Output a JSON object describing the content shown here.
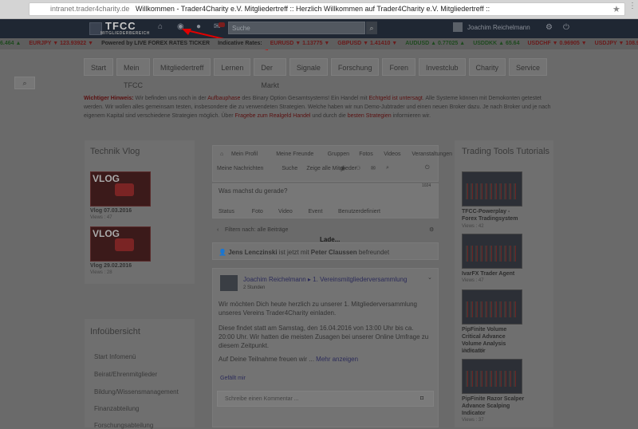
{
  "browser": {
    "url_host": "intranet.trader4charity.de",
    "page_title": "Willkommen - Trader4Charity e.V. Mitgliedertreff :: Herzlich Willkommen auf Trader4Charity e.V. Mitgliedertreff ::"
  },
  "header": {
    "logo_main": "TFCC",
    "logo_sub": "MITGLIEDERBEREICH",
    "search_placeholder": "Suche",
    "username": "Joachim Reichelmann"
  },
  "ticker": [
    {
      "text": "6.464 ▲",
      "color": "green"
    },
    {
      "text": "EURJPY ▼ 123.93922 ▼",
      "color": "red"
    },
    {
      "text": "Powered by LIVE FOREX RATES TICKER",
      "color": "plain"
    },
    {
      "text": "Indicative Rates:",
      "color": "plain"
    },
    {
      "text": "EURUSD ▼ 1.13775 ▼",
      "color": "red"
    },
    {
      "text": "GBPUSD ▼ 1.41410 ▼",
      "color": "red"
    },
    {
      "text": "AUDUSD ▲ 0.77025 ▲",
      "color": "green"
    },
    {
      "text": "USDDKK ▲ 65.64",
      "color": "green"
    },
    {
      "text": "USDCHF ▼ 0.96905 ▼",
      "color": "red"
    },
    {
      "text": "USDJPY ▼ 108.958 ▼",
      "color": "red"
    }
  ],
  "tabs": [
    "Start",
    "Mein TFCC",
    "Mitgliedertreff",
    "Lernen",
    "Der Markt",
    "Signale",
    "Forschung",
    "Foren",
    "Investclub",
    "Charity",
    "Service"
  ],
  "notice": {
    "label": "Wichtiger Hinweis:",
    "text1": " Wir befinden uns noch in der ",
    "hl1": "Aufbauphase",
    "text2": " des Binary Option Gesamtsystems! Ein Handel mit ",
    "hl2": "Echtgeld ist untersagt",
    "text3": ". Alle Systeme können mit Demokonten getestet werden. Wir wollen alles gemeinsam testen, insbesondere die zu verwendeten Strategien. Welche haben wir nun Demo-Jubtrader und einen neuen Broker dazu. Je nach Broker und je nach eigenem Kapital sind verschiedene Strategien möglich. Über ",
    "hl3": "Fragebe zum Realgeld Handel",
    "text4": " und durch die ",
    "hl4": "besten Strategien",
    "text5": " informieren wir."
  },
  "left": {
    "vlog_title": "Technik Vlog",
    "vlogs": [
      {
        "thumb": "VLOG",
        "title": "Vlog 07.03.2016",
        "views": "Views : 47"
      },
      {
        "thumb": "VLOG",
        "title": "Vlog 29.02.2016",
        "views": "Views : 28"
      }
    ],
    "info_title": "Infoübersicht",
    "info_items": [
      "Start Infomenü",
      "Beirat/Ehrenmitglieder",
      "Bildung/Wissensmanagement",
      "Finanzabteilung",
      "Forschungsabteilung"
    ]
  },
  "center": {
    "nav1": [
      "Mein Profil",
      "Meine Freunde",
      "Gruppen",
      "Fotos",
      "Videos",
      "Veranstaltungen"
    ],
    "nav2": [
      "Meine Nachrichten",
      "Suche",
      "Zeige alle Mitglieder"
    ],
    "status_placeholder": "Was machst du gerade?",
    "char_count": "1024",
    "post_types": [
      "Status",
      "Foto",
      "Video",
      "Event",
      "Benutzerdefiniert"
    ],
    "filter": "Filtern nach: alle Beiträge",
    "loading": "Lade...",
    "friend_a": "Jens Lenczinski",
    "friend_mid": " ist jetzt mit ",
    "friend_b": "Peter Claussen",
    "friend_end": " befreundet",
    "post_author": "Joachim Reichelmann",
    "post_target": "1. Vereinsmitgliederversammlung",
    "post_time": "2 Stunden",
    "post_p1": "Wir möchten Dich heute herzlich zu unserer 1. Mitgliederversammlung unseres Vereins Trader4Charity einladen.",
    "post_p2": "Diese findet statt am Samstag, den 16.04.2016 von 13:00 Uhr bis ca. 20:00 Uhr. Wir hatten die meisten Zusagen bei unserer Online Umfrage zu diesem Zeitpunkt.",
    "post_p3": "Auf Deine Teilnahme freuen wir ...",
    "more": "Mehr anzeigen",
    "like": "Gefällt mir",
    "comment_placeholder": "Schreibe einen Kommentar ..."
  },
  "right": {
    "title": "Trading Tools Tutorials",
    "items": [
      {
        "title": "TFCC-Powerplay - Forex Tradingsystem",
        "views": "Views : 42"
      },
      {
        "title": "IvarFX Trader Agent",
        "views": "Views : 47"
      },
      {
        "title": "PipFinite Volume Critical Advance Volume Analysis Indicator",
        "views": "Views : 38"
      },
      {
        "title": "PipFinite Razor Scalper Advance Scalping Indicator",
        "views": "Views : 37"
      }
    ]
  }
}
